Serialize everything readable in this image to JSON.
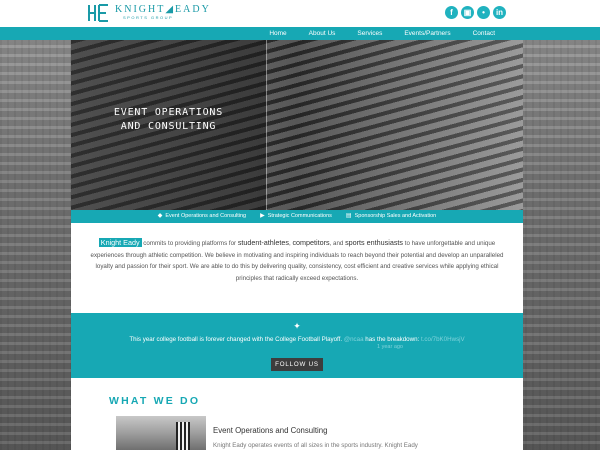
{
  "brand": {
    "name": "KNIGHT◢EADY",
    "sub": "SPORTS GROUP"
  },
  "socials": [
    {
      "icon": "facebook-icon",
      "glyph": "f"
    },
    {
      "icon": "instagram-icon",
      "glyph": "▣"
    },
    {
      "icon": "twitter-icon",
      "glyph": "•"
    },
    {
      "icon": "linkedin-icon",
      "glyph": "in"
    }
  ],
  "nav": [
    "Home",
    "About Us",
    "Services",
    "Events/Partners",
    "Contact"
  ],
  "hero": {
    "line1": "EVENT OPERATIONS",
    "line2": "AND CONSULTING"
  },
  "services": [
    {
      "icon": "tag-icon",
      "glyph": "◆",
      "label": "Event Operations and Consulting"
    },
    {
      "icon": "megaphone-icon",
      "glyph": "▶",
      "label": "Strategic Communications"
    },
    {
      "icon": "billboard-icon",
      "glyph": "▤",
      "label": "Sponsorship Sales and Activation"
    }
  ],
  "intro": {
    "brand": "Knight Eady",
    "p1": " commits to providing platforms for ",
    "em1": "student-athletes",
    "c1": ", ",
    "em2": "competitors",
    "c2": ", and ",
    "em3": "sports enthusiasts",
    "rest": " to have unforgettable and unique experiences through athletic competition. We believe in motivating and inspiring individuals to reach beyond their potential and develop an unparalleled loyalty and passion for their sport. We are able to do this by delivering quality, consistency, cost efficient and creative services while applying ethical principles that radically exceed expectations."
  },
  "tweet": {
    "text": "This year college football is forever changed with the College Football Playoff. ",
    "handle": "@ncaa",
    "mid": " has the breakdown: ",
    "link": "t.co/7bK0HwsjV",
    "time": "1 year ago"
  },
  "follow_label": "FOLLOW US",
  "what_we_do": "WHAT WE DO",
  "event": {
    "title": "Event Operations and Consulting",
    "text": "Knight Eady operates events of all sizes in the sports industry. Knight Eady"
  },
  "colors": {
    "teal": "#17a8b4",
    "dark_button": "#3d3d3d"
  }
}
